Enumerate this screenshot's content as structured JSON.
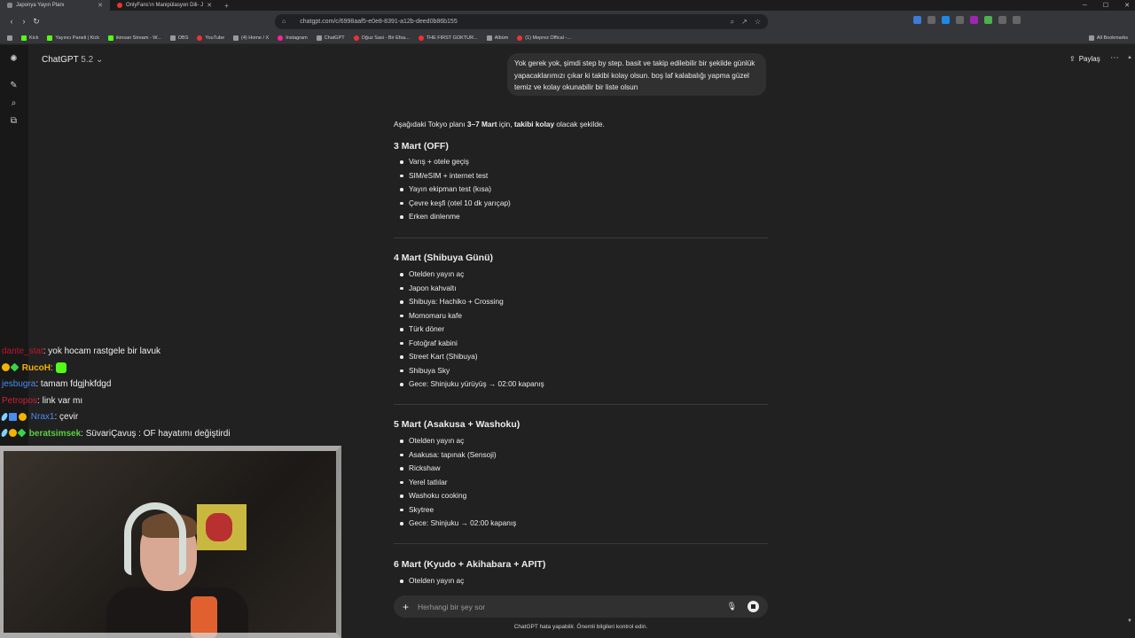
{
  "browser": {
    "tabs": [
      {
        "label": "Japonya Yayın Planı",
        "active": true
      },
      {
        "label": "OnlyFans'ın Manipülasyon Dili- J",
        "active": false
      }
    ],
    "url": "chatgpt.com/c/6998aaf5-e0e8-8391-a12b-deed0b86b155",
    "bookmarks": [
      "Kick",
      "Yayıncı Paneli | Kick",
      "ikinsan Stream - W...",
      "OBS",
      "YouTube",
      "(4) Home / X",
      "Instagram",
      "ChatGPT",
      "Oğuz Sasi - Bir Efsa...",
      "THE FIRST GOKTUR...",
      "Albüm",
      "(1) Meprez Offical -..."
    ],
    "all_bookmarks": "All Bookmarks"
  },
  "app": {
    "model_name": "ChatGPT",
    "model_version": "5.2",
    "share_label": "Paylaş",
    "user_message": "Yok gerek yok, şimdi step by step. basit ve takip edilebilir bir şekilde günlük yapacaklarımızı çıkar ki takibi kolay olsun. boş laf kalabalığı yapma güzel temiz ve kolay okunabilir bir liste olsun",
    "intro_pre": "Aşağıdaki Tokyo planı ",
    "intro_b1": "3–7 Mart",
    "intro_mid": " için, ",
    "intro_b2": "takibi kolay",
    "intro_post": " olacak şekilde.",
    "days": [
      {
        "title": "3 Mart (OFF)",
        "items": [
          "Varış + otele geçiş",
          "SIM/eSIM + internet test",
          "Yayın ekipman test (kısa)",
          "Çevre keşfi (otel 10 dk yarıçap)",
          "Erken dinlenme"
        ]
      },
      {
        "title": "4 Mart (Shibuya Günü)",
        "items": [
          "Otelden yayın aç",
          "Japon kahvaltı",
          "Shibuya: Hachiko + Crossing",
          "Momomaru kafe",
          "Türk döner",
          "Fotoğraf kabini",
          "Street Kart (Shibuya)",
          "Shibuya Sky",
          "Gece: Shinjuku yürüyüş → 02:00 kapanış"
        ]
      },
      {
        "title": "5 Mart (Asakusa + Washoku)",
        "items": [
          "Otelden yayın aç",
          "Asakusa: tapınak (Sensoji)",
          "Rickshaw",
          "Yerel tatlılar",
          "Washoku cooking",
          "Skytree",
          "Gece: Shinjuku → 02:00 kapanış"
        ]
      },
      {
        "title": "6 Mart (Kyudo + Akihabara + APIT)",
        "items": [
          "Otelden yayın aç"
        ]
      }
    ],
    "composer_placeholder": "Herhangi bir şey sor",
    "disclaimer": "ChatGPT hata yapabilir. Önemli bilgileri kontrol edin."
  },
  "stream_chat": [
    {
      "user": "dante_stat",
      "color": "#c0152a",
      "message": "yok hocam rastgele bir lavuk",
      "badges": []
    },
    {
      "user": "RucoH",
      "color": "#f3b400",
      "message": "",
      "badges": [
        "y",
        "g"
      ],
      "emote": true
    },
    {
      "user": "jesbugra",
      "color": "#4a8cf0",
      "message": "tamam fdgjhkfdgd",
      "badges": []
    },
    {
      "user": "Petropos",
      "color": "#d0203a",
      "message": "link var mı",
      "badges": []
    },
    {
      "user": "Nrax1",
      "color": "#4a8cf0",
      "message": "çevir",
      "badges": [
        "s",
        "b",
        "y"
      ]
    },
    {
      "user": "beratsimsek",
      "color": "#58d040",
      "message": "SüvariÇavuş : OF hayatımı değiştirdi",
      "badges": [
        "s",
        "y",
        "g"
      ]
    }
  ]
}
